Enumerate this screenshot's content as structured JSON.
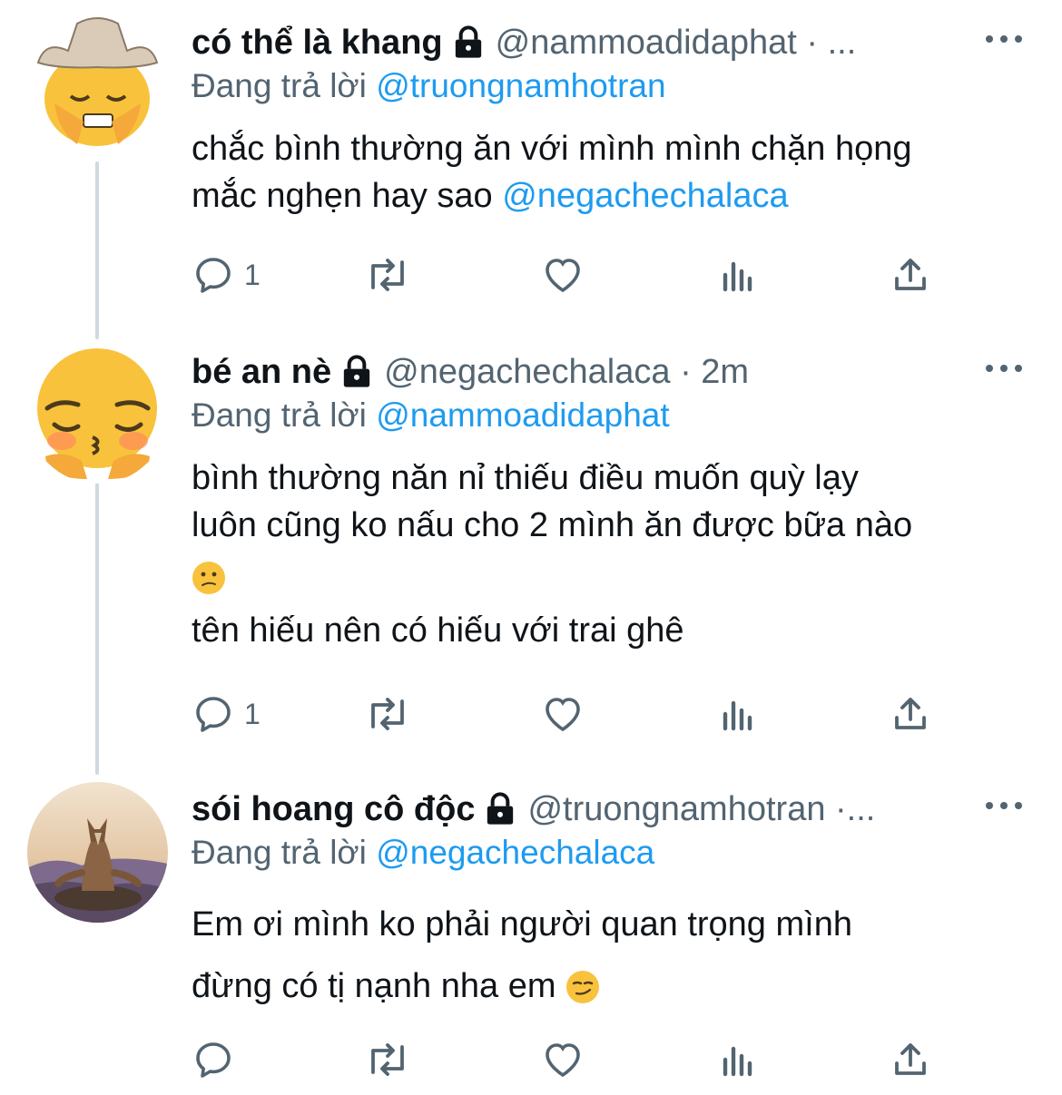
{
  "tweets": [
    {
      "display_name": "có thể là khang",
      "handle_meta": "@nammoadidaphat · ...",
      "replying_prefix": "Đang trả lời ",
      "replying_to": "@truongnamhotran",
      "text_lines": [
        "chắc bình thường ăn với mình mình chặn họng",
        "mắc nghẹn hay sao "
      ],
      "text_mention": "@negachechalaca",
      "reply_count": "1",
      "avatar_icon": "cowboy-face-emoji-avatar"
    },
    {
      "display_name": "bé an nè",
      "handle_meta": "@negachechalaca · 2m",
      "replying_prefix": "Đang trả lời ",
      "replying_to": "@nammoadidaphat",
      "text_lines": [
        "bình thường năn nỉ thiếu điều muốn quỳ lạy",
        "luôn cũng ko nấu cho 2 mình ăn được bữa nào",
        "tên hiếu nên có hiếu với trai ghê"
      ],
      "reply_count": "1",
      "avatar_icon": "pleading-kiss-emoji-avatar"
    },
    {
      "display_name": "sói hoang cô độc",
      "handle_meta": "@truongnamhotran ·...",
      "replying_prefix": "Đang trả lời ",
      "replying_to": "@negachechalaca",
      "text_lines": [
        "Em ơi mình ko phải người quan trọng mình",
        "đừng có tị nạnh nha em "
      ],
      "reply_count": "",
      "avatar_icon": "wolf-meditating-avatar"
    }
  ],
  "colors": {
    "text": "#0f1419",
    "secondary": "#536471",
    "accent": "#1d9bf0",
    "thread_line": "#cfd9de"
  }
}
